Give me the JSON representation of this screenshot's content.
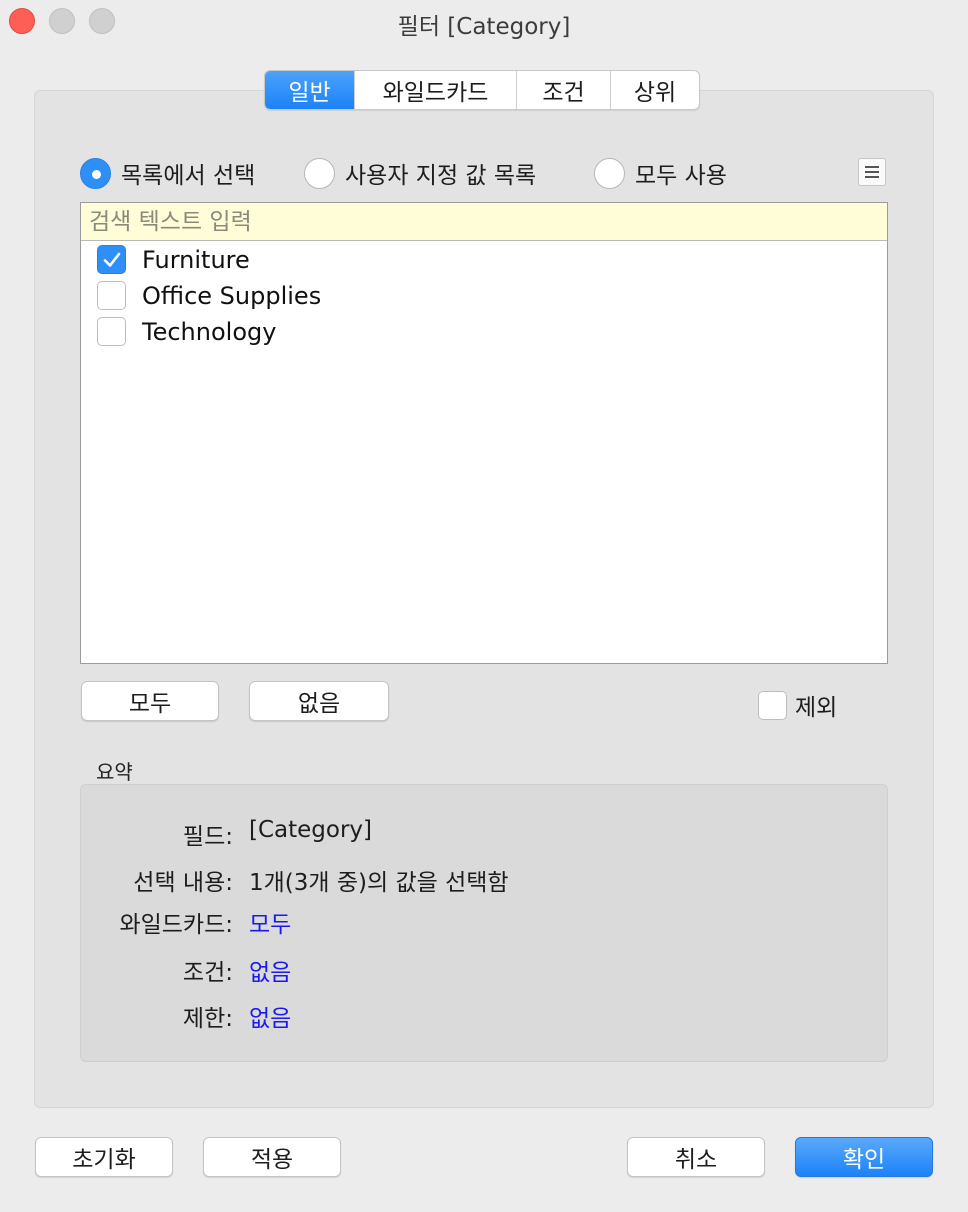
{
  "window": {
    "title": "필터 [Category]"
  },
  "tabs": [
    {
      "label": "일반",
      "active": true
    },
    {
      "label": "와일드카드",
      "active": false
    },
    {
      "label": "조건",
      "active": false
    },
    {
      "label": "상위",
      "active": false
    }
  ],
  "mode": {
    "options": [
      {
        "label": "목록에서 선택",
        "checked": true
      },
      {
        "label": "사용자 지정 값 목록",
        "checked": false
      },
      {
        "label": "모두 사용",
        "checked": false
      }
    ]
  },
  "search": {
    "placeholder": "검색 텍스트 입력",
    "value": ""
  },
  "values": [
    {
      "label": "Furniture",
      "checked": true
    },
    {
      "label": "Office Supplies",
      "checked": false
    },
    {
      "label": "Technology",
      "checked": false
    }
  ],
  "list_buttons": {
    "all": "모두",
    "none": "없음"
  },
  "exclude": {
    "label": "제외",
    "checked": false
  },
  "summary": {
    "title": "요약",
    "rows": [
      {
        "key": "필드:",
        "value": "[Category]"
      },
      {
        "key": "선택 내용:",
        "value": "1개(3개 중)의 값을 선택함"
      },
      {
        "key": "와일드카드:",
        "value": "모두"
      },
      {
        "key": "조건:",
        "value": "없음"
      },
      {
        "key": "제한:",
        "value": "없음"
      }
    ]
  },
  "footer": {
    "reset": "초기화",
    "apply": "적용",
    "cancel": "취소",
    "ok": "확인"
  },
  "colors": {
    "accent": "#2f8ff9",
    "search_bg": "#fefdd8",
    "link": "#1a1aee"
  }
}
